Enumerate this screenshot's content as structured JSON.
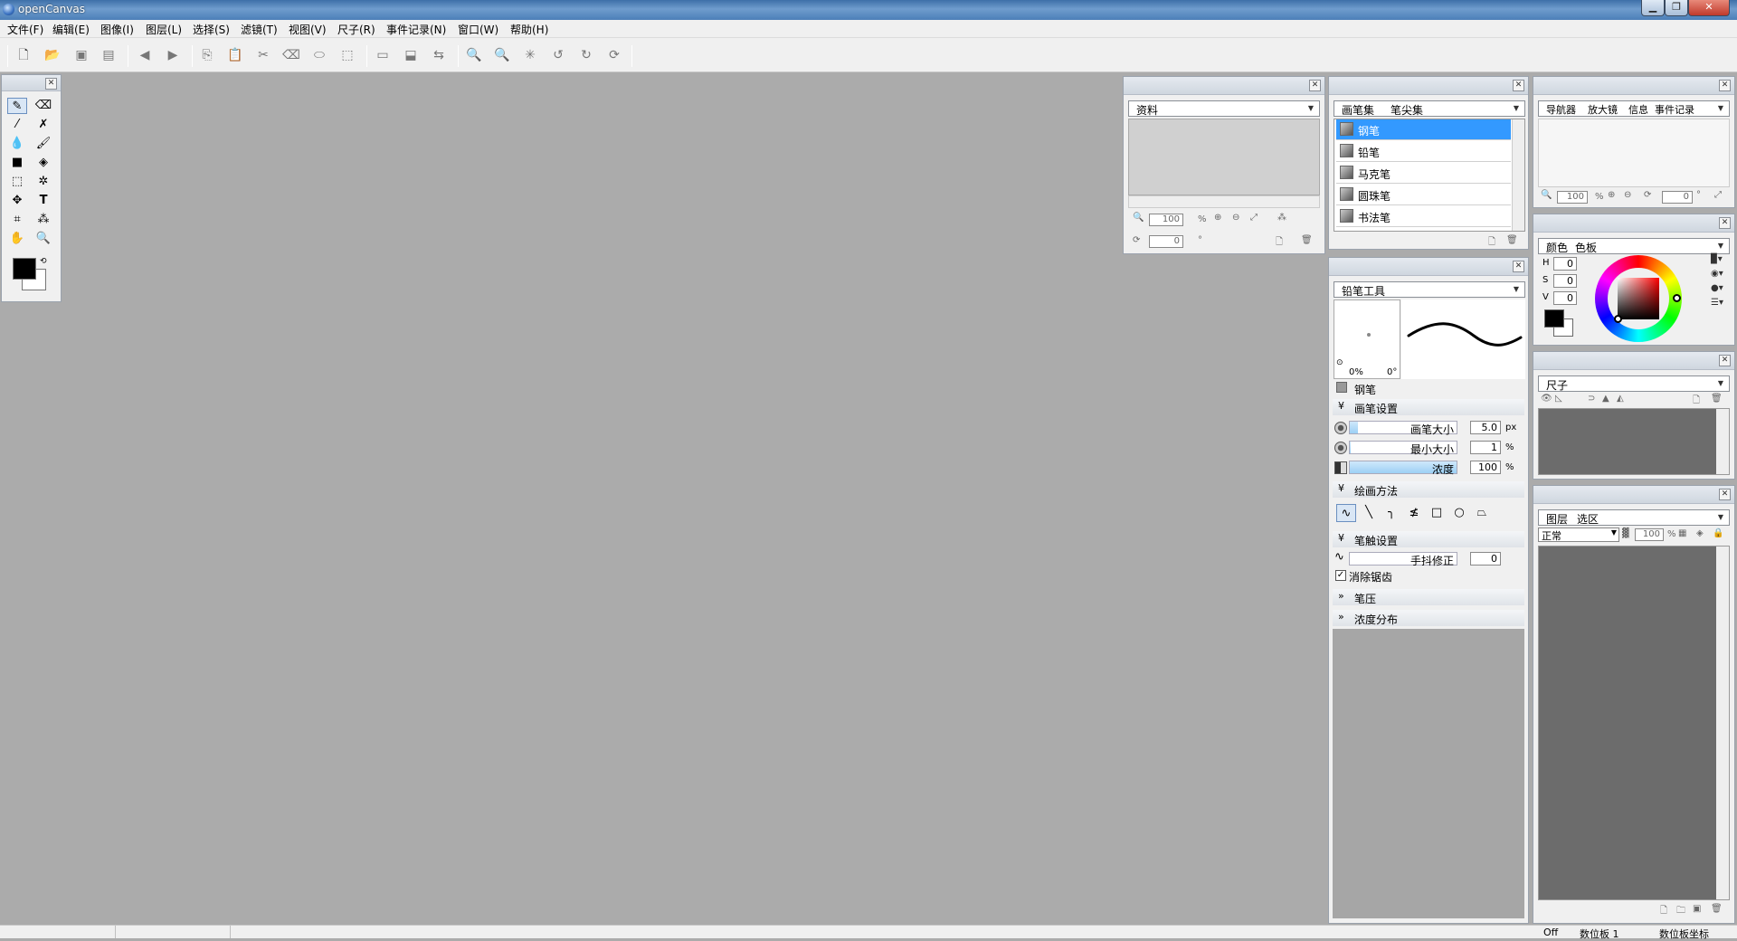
{
  "window": {
    "title": "openCanvas",
    "min_label": "▁",
    "max_label": "❐",
    "close_label": "✕"
  },
  "menu": {
    "items": [
      "文件(F)",
      "编辑(E)",
      "图像(I)",
      "图层(L)",
      "选择(S)",
      "滤镜(T)",
      "视图(V)",
      "尺子(R)",
      "事件记录(N)",
      "窗口(W)",
      "帮助(H)"
    ]
  },
  "toolbar": {
    "icons": [
      "new-file-icon",
      "open-icon",
      "save-icon",
      "save-as-icon",
      "prev-icon",
      "next-icon",
      "copy-icon",
      "paste-icon",
      "cut-icon",
      "delete-icon",
      "erase-icon",
      "transform-icon",
      "select-all-icon",
      "deselect-icon",
      "flip-icon",
      "zoom-in-icon",
      "zoom-out-icon",
      "fit-icon",
      "rotate-left-icon",
      "rotate-right-icon",
      "reset-rotate-icon"
    ]
  },
  "material": {
    "tab": "资料",
    "zoom": "100",
    "zoom_unit": "%",
    "angle": "0",
    "angle_unit": "°"
  },
  "brushes": {
    "tab1": "画笔集",
    "tab2": "笔尖集",
    "items": [
      "钢笔",
      "铅笔",
      "马克笔",
      "圆珠笔",
      "书法笔"
    ]
  },
  "navigator": {
    "tab1": "导航器",
    "tab2": "放大镜",
    "tab3": "信息",
    "tab4": "事件记录",
    "zoom": "100",
    "zoom_unit": "%",
    "angle": "0",
    "angle_unit": "°"
  },
  "color": {
    "tab1": "颜色",
    "tab2": "色板",
    "h_label": "H",
    "h": "0",
    "s_label": "S",
    "s": "0",
    "v_label": "V",
    "v": "0",
    "fg": "#000000",
    "bg": "#ffffff"
  },
  "ruler": {
    "tab": "尺子"
  },
  "layers": {
    "tab1": "图层",
    "tab2": "选区",
    "blend": "正常",
    "opacity": "100",
    "opacity_unit": "%"
  },
  "pencil_tool": {
    "tab": "铅笔工具",
    "preview_percent": "0%",
    "preview_angle": "0°",
    "brush_name": "钢笔",
    "sec_brush_settings": "画笔设置",
    "size_label": "画笔大小",
    "size": "5.0",
    "size_unit": "px",
    "size_level": 0.08,
    "min_label": "最小大小",
    "min": "1",
    "min_unit": "%",
    "min_level": 0.01,
    "density_label": "浓度",
    "density": "100",
    "density_unit": "%",
    "density_level": 1.0,
    "sec_draw_method": "绘画方法",
    "sec_stroke": "笔触设置",
    "stabilizer_label": "手抖修正",
    "stabilizer": "0",
    "antialias_label": "消除锯齿",
    "sec_pressure": "笔压",
    "sec_density_dist": "浓度分布"
  },
  "status": {
    "left": "",
    "off": "Off",
    "tablet1": "数位板 1",
    "tablet_coords": "数位板坐标"
  }
}
